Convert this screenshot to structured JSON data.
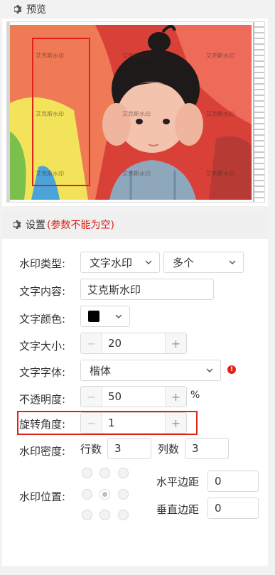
{
  "preview": {
    "title": "预览",
    "watermark_text": "艾克斯水印"
  },
  "settings": {
    "title": "设置",
    "note": "(参数不能为空)",
    "type": {
      "label": "水印类型:",
      "value": "文字水印",
      "mode": "多个"
    },
    "content": {
      "label": "文字内容:",
      "value": "艾克斯水印"
    },
    "color": {
      "label": "文字颜色:",
      "value": "#000000"
    },
    "size": {
      "label": "文字大小:",
      "value": "20",
      "minus": "−",
      "plus": "+"
    },
    "font": {
      "label": "文字字体:",
      "value": "楷体"
    },
    "opacity": {
      "label": "不透明度:",
      "value": "50",
      "unit": "%",
      "minus": "−",
      "plus": "+"
    },
    "rotation": {
      "label": "旋转角度:",
      "value": "1",
      "minus": "−",
      "plus": "+"
    },
    "density": {
      "label": "水印密度:",
      "rows_label": "行数",
      "rows": "3",
      "cols_label": "列数",
      "cols": "3"
    },
    "position": {
      "label": "水印位置:",
      "selected": "center",
      "h_margin_label": "水平边距",
      "h_margin": "0",
      "v_margin_label": "垂直边距",
      "v_margin": "0"
    }
  },
  "colors": {
    "accent_red": "#e0221b"
  }
}
